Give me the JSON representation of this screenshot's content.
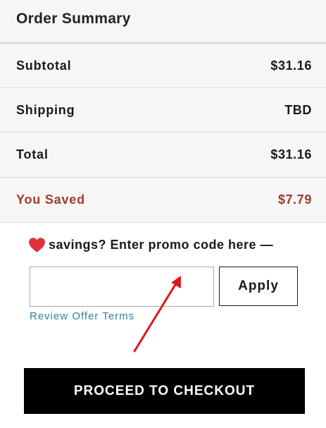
{
  "summary": {
    "title": "Order Summary",
    "rows": [
      {
        "label": "Subtotal",
        "value": "$31.16"
      },
      {
        "label": "Shipping",
        "value": "TBD"
      },
      {
        "label": "Total",
        "value": "$31.16"
      },
      {
        "label": "You Saved",
        "value": "$7.79"
      }
    ]
  },
  "promo": {
    "heading": "savings?  Enter promo code here —",
    "input_value": "",
    "apply_label": "Apply",
    "terms_link": "Review Offer Terms"
  },
  "checkout": {
    "label": "PROCEED TO CHECKOUT"
  },
  "colors": {
    "saved": "#a13a2d",
    "heart": "#e0303f",
    "link": "#2d7fa9",
    "annotation_arrow": "#e0141e"
  },
  "icons": {
    "promo_heart": "heart-icon"
  }
}
